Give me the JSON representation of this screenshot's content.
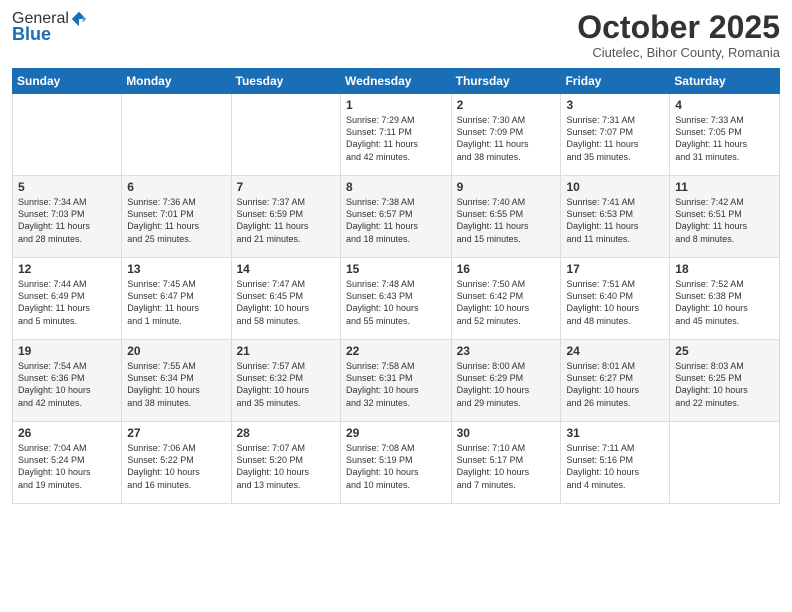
{
  "header": {
    "logo_line1": "General",
    "logo_line2": "Blue",
    "month_title": "October 2025",
    "location": "Ciutelec, Bihor County, Romania"
  },
  "weekdays": [
    "Sunday",
    "Monday",
    "Tuesday",
    "Wednesday",
    "Thursday",
    "Friday",
    "Saturday"
  ],
  "weeks": [
    [
      {
        "day": "",
        "content": ""
      },
      {
        "day": "",
        "content": ""
      },
      {
        "day": "",
        "content": ""
      },
      {
        "day": "1",
        "content": "Sunrise: 7:29 AM\nSunset: 7:11 PM\nDaylight: 11 hours\nand 42 minutes."
      },
      {
        "day": "2",
        "content": "Sunrise: 7:30 AM\nSunset: 7:09 PM\nDaylight: 11 hours\nand 38 minutes."
      },
      {
        "day": "3",
        "content": "Sunrise: 7:31 AM\nSunset: 7:07 PM\nDaylight: 11 hours\nand 35 minutes."
      },
      {
        "day": "4",
        "content": "Sunrise: 7:33 AM\nSunset: 7:05 PM\nDaylight: 11 hours\nand 31 minutes."
      }
    ],
    [
      {
        "day": "5",
        "content": "Sunrise: 7:34 AM\nSunset: 7:03 PM\nDaylight: 11 hours\nand 28 minutes."
      },
      {
        "day": "6",
        "content": "Sunrise: 7:36 AM\nSunset: 7:01 PM\nDaylight: 11 hours\nand 25 minutes."
      },
      {
        "day": "7",
        "content": "Sunrise: 7:37 AM\nSunset: 6:59 PM\nDaylight: 11 hours\nand 21 minutes."
      },
      {
        "day": "8",
        "content": "Sunrise: 7:38 AM\nSunset: 6:57 PM\nDaylight: 11 hours\nand 18 minutes."
      },
      {
        "day": "9",
        "content": "Sunrise: 7:40 AM\nSunset: 6:55 PM\nDaylight: 11 hours\nand 15 minutes."
      },
      {
        "day": "10",
        "content": "Sunrise: 7:41 AM\nSunset: 6:53 PM\nDaylight: 11 hours\nand 11 minutes."
      },
      {
        "day": "11",
        "content": "Sunrise: 7:42 AM\nSunset: 6:51 PM\nDaylight: 11 hours\nand 8 minutes."
      }
    ],
    [
      {
        "day": "12",
        "content": "Sunrise: 7:44 AM\nSunset: 6:49 PM\nDaylight: 11 hours\nand 5 minutes."
      },
      {
        "day": "13",
        "content": "Sunrise: 7:45 AM\nSunset: 6:47 PM\nDaylight: 11 hours\nand 1 minute."
      },
      {
        "day": "14",
        "content": "Sunrise: 7:47 AM\nSunset: 6:45 PM\nDaylight: 10 hours\nand 58 minutes."
      },
      {
        "day": "15",
        "content": "Sunrise: 7:48 AM\nSunset: 6:43 PM\nDaylight: 10 hours\nand 55 minutes."
      },
      {
        "day": "16",
        "content": "Sunrise: 7:50 AM\nSunset: 6:42 PM\nDaylight: 10 hours\nand 52 minutes."
      },
      {
        "day": "17",
        "content": "Sunrise: 7:51 AM\nSunset: 6:40 PM\nDaylight: 10 hours\nand 48 minutes."
      },
      {
        "day": "18",
        "content": "Sunrise: 7:52 AM\nSunset: 6:38 PM\nDaylight: 10 hours\nand 45 minutes."
      }
    ],
    [
      {
        "day": "19",
        "content": "Sunrise: 7:54 AM\nSunset: 6:36 PM\nDaylight: 10 hours\nand 42 minutes."
      },
      {
        "day": "20",
        "content": "Sunrise: 7:55 AM\nSunset: 6:34 PM\nDaylight: 10 hours\nand 38 minutes."
      },
      {
        "day": "21",
        "content": "Sunrise: 7:57 AM\nSunset: 6:32 PM\nDaylight: 10 hours\nand 35 minutes."
      },
      {
        "day": "22",
        "content": "Sunrise: 7:58 AM\nSunset: 6:31 PM\nDaylight: 10 hours\nand 32 minutes."
      },
      {
        "day": "23",
        "content": "Sunrise: 8:00 AM\nSunset: 6:29 PM\nDaylight: 10 hours\nand 29 minutes."
      },
      {
        "day": "24",
        "content": "Sunrise: 8:01 AM\nSunset: 6:27 PM\nDaylight: 10 hours\nand 26 minutes."
      },
      {
        "day": "25",
        "content": "Sunrise: 8:03 AM\nSunset: 6:25 PM\nDaylight: 10 hours\nand 22 minutes."
      }
    ],
    [
      {
        "day": "26",
        "content": "Sunrise: 7:04 AM\nSunset: 5:24 PM\nDaylight: 10 hours\nand 19 minutes."
      },
      {
        "day": "27",
        "content": "Sunrise: 7:06 AM\nSunset: 5:22 PM\nDaylight: 10 hours\nand 16 minutes."
      },
      {
        "day": "28",
        "content": "Sunrise: 7:07 AM\nSunset: 5:20 PM\nDaylight: 10 hours\nand 13 minutes."
      },
      {
        "day": "29",
        "content": "Sunrise: 7:08 AM\nSunset: 5:19 PM\nDaylight: 10 hours\nand 10 minutes."
      },
      {
        "day": "30",
        "content": "Sunrise: 7:10 AM\nSunset: 5:17 PM\nDaylight: 10 hours\nand 7 minutes."
      },
      {
        "day": "31",
        "content": "Sunrise: 7:11 AM\nSunset: 5:16 PM\nDaylight: 10 hours\nand 4 minutes."
      },
      {
        "day": "",
        "content": ""
      }
    ]
  ]
}
